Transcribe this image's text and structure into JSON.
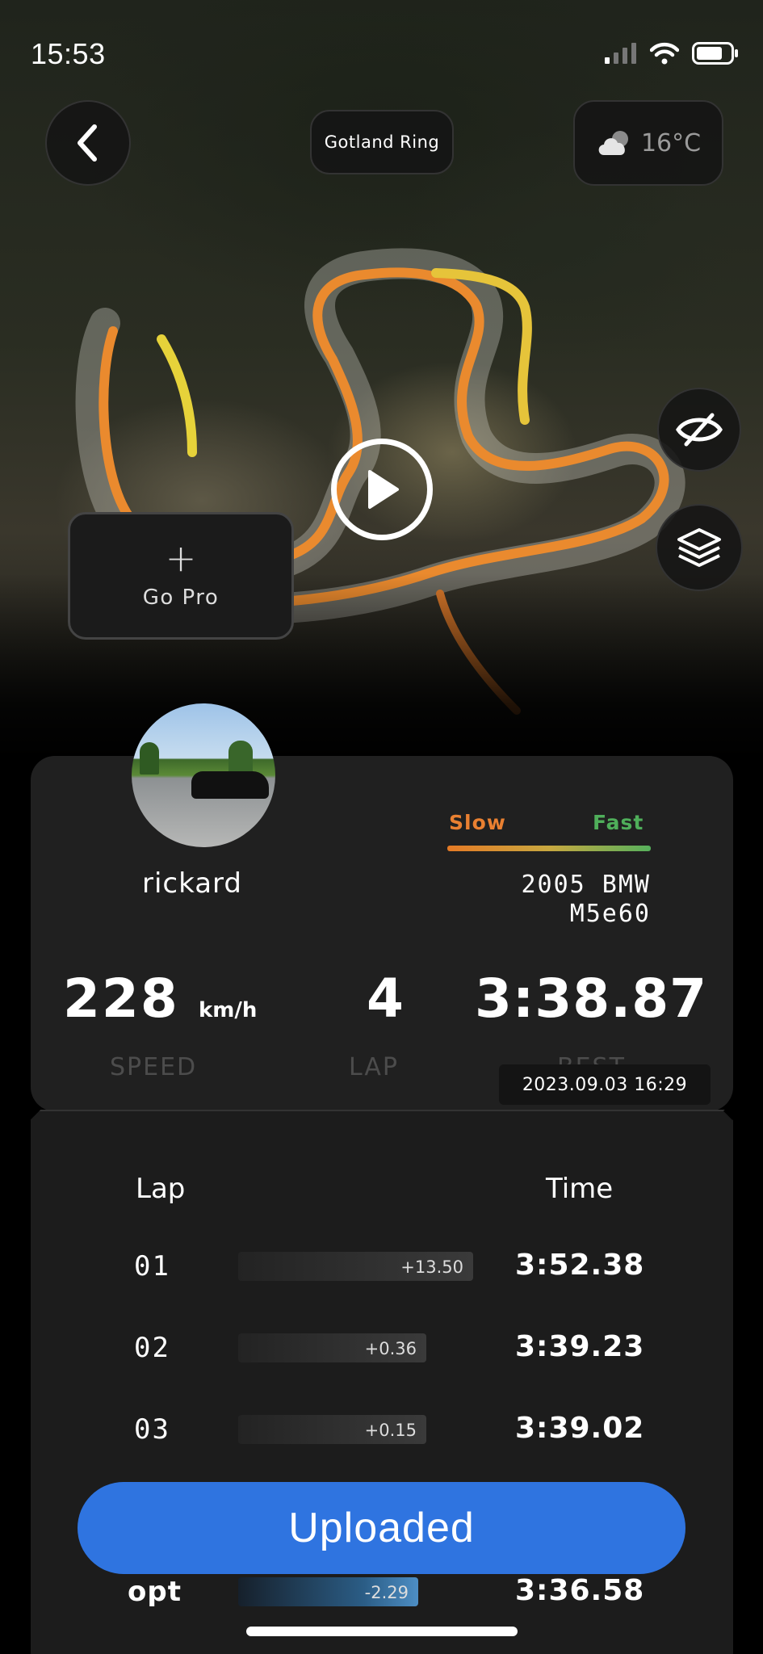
{
  "status_bar": {
    "time": "15:53"
  },
  "header": {
    "track_name": "Gotland Ring",
    "temperature": "16°C",
    "weather_icon": "cloud-sun-icon"
  },
  "map": {
    "gopro_plus": "+",
    "gopro_label": "Go Pro"
  },
  "rider": {
    "username": "rickard",
    "car": [
      "2005 BMW",
      "M5e60"
    ]
  },
  "legend": {
    "slow": "Slow",
    "fast": "Fast",
    "slow_color": "#e98031",
    "fast_color": "#4fae5a"
  },
  "stats": {
    "speed": "228",
    "speed_unit": "km/h",
    "speed_label": "SPEED",
    "lap": "4",
    "lap_label": "LAP",
    "best": "3:38.87",
    "best_label": "BEST",
    "date": "2023.09.03 16:29"
  },
  "table": {
    "col_lap": "Lap",
    "col_time": "Time",
    "rows": [
      {
        "lap": "01",
        "delta": "+13.50",
        "time": "3:52.38"
      },
      {
        "lap": "02",
        "delta": "+0.36",
        "time": "3:39.23"
      },
      {
        "lap": "03",
        "delta": "+0.15",
        "time": "3:39.02"
      },
      {
        "lap": "opt",
        "delta": "-2.29",
        "time": "3:36.58"
      }
    ]
  },
  "upload_button": "Uploaded",
  "accent": "#2f74e0"
}
